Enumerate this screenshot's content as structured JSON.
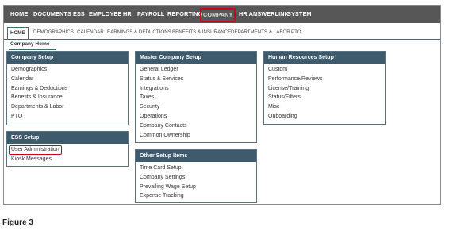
{
  "top_nav": [
    {
      "label": "HOME"
    },
    {
      "label": "DOCUMENTS"
    },
    {
      "label": "ESS"
    },
    {
      "label": "EMPLOYEE"
    },
    {
      "label": "HR"
    },
    {
      "label": "PAYROLL"
    },
    {
      "label": "REPORTING"
    },
    {
      "label": "COMPANY",
      "active": true
    },
    {
      "label": "HR ANSWERLINK"
    },
    {
      "label": "SYSTEM"
    }
  ],
  "sub_nav": [
    {
      "label": "HOME",
      "active": true
    },
    {
      "label": "DEMOGRAPHICS"
    },
    {
      "label": "CALENDAR"
    },
    {
      "label": "EARNINGS & DEDUCTIONS"
    },
    {
      "label": "BENEFITS & INSURANCE"
    },
    {
      "label": "DEPARTMENTS & LABOR"
    },
    {
      "label": "PTO"
    }
  ],
  "breadcrumb": "Company Home",
  "panels": {
    "company_setup": {
      "title": "Company Setup",
      "items": [
        "Demographics",
        "Calendar",
        "Earnings & Deductions",
        "Benefits & Insurance",
        "Departments & Labor",
        "PTO"
      ]
    },
    "ess_setup": {
      "title": "ESS Setup",
      "items": [
        "User Administration",
        "Kiosk Messages"
      ]
    },
    "master_company_setup": {
      "title": "Master Company Setup",
      "items": [
        "General Ledger",
        "Status & Services",
        "Integrations",
        "Taxes",
        "Security",
        "Operations",
        "Company Contacts",
        "Common Ownership"
      ]
    },
    "other_setup_items": {
      "title": "Other Setup Items",
      "items": [
        "Time Card Setup",
        "Company Settings",
        "Prevailing Wage Setup",
        "Expense Tracking"
      ]
    },
    "hr_setup": {
      "title": "Human Resources Setup",
      "items": [
        "Custom",
        "Performance/Reviews",
        "License/Training",
        "Status/Filters",
        "Misc",
        "Onboarding"
      ]
    }
  },
  "caption": "Figure 3",
  "colors": {
    "nav_bg": "#575757",
    "panel_header": "#3e5a6d",
    "highlight": "#d0011b"
  }
}
